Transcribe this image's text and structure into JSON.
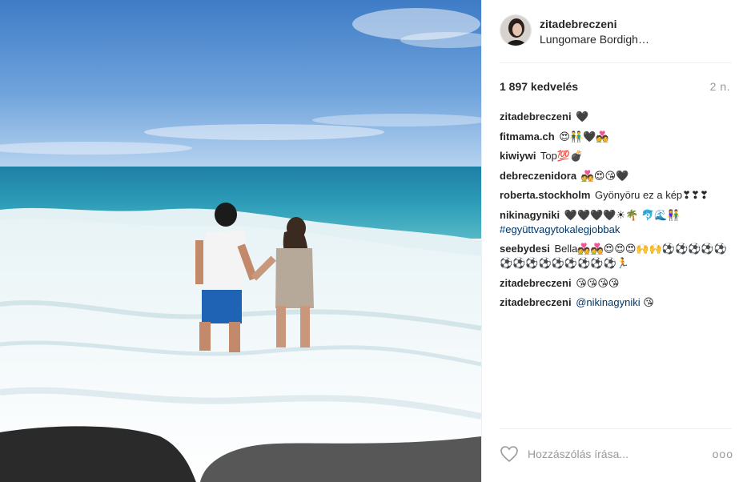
{
  "post": {
    "username": "zitadebreczeni",
    "location": "Lungomare Bordighera",
    "likes": "1 897 kedvelés",
    "time": "2 n."
  },
  "comments": [
    {
      "author": "zitadebreczeni",
      "text": "🖤"
    },
    {
      "author": "fitmama.ch",
      "text": "😍👬🖤💑"
    },
    {
      "author": "kiwiywi",
      "text": "Top💯💣"
    },
    {
      "author": "debreczenidora",
      "text": "💑😍😘🖤"
    },
    {
      "author": "roberta.stockholm",
      "text": "Gyönyöru ez a kép❣❣❣"
    },
    {
      "author": "nikinagyniki",
      "text": "🖤🖤🖤🖤☀🌴 🐬🌊👫",
      "link": "#együttvagytokalegjobbak"
    },
    {
      "author": "seebydesi",
      "text": "Bella💑💑😍😍😍🙌🙌⚽⚽⚽⚽⚽⚽⚽⚽⚽⚽⚽⚽⚽⚽🏃"
    },
    {
      "author": "zitadebreczeni",
      "text": "😘😘😘😘"
    },
    {
      "author": "zitadebreczeni",
      "text": "😘",
      "mention": "@nikinagyniki"
    }
  ],
  "footer": {
    "placeholder": "Hozzászólás írása...",
    "more": "ooo"
  },
  "icons": {
    "like": "heart-outline-icon",
    "more": "more-options-icon"
  }
}
